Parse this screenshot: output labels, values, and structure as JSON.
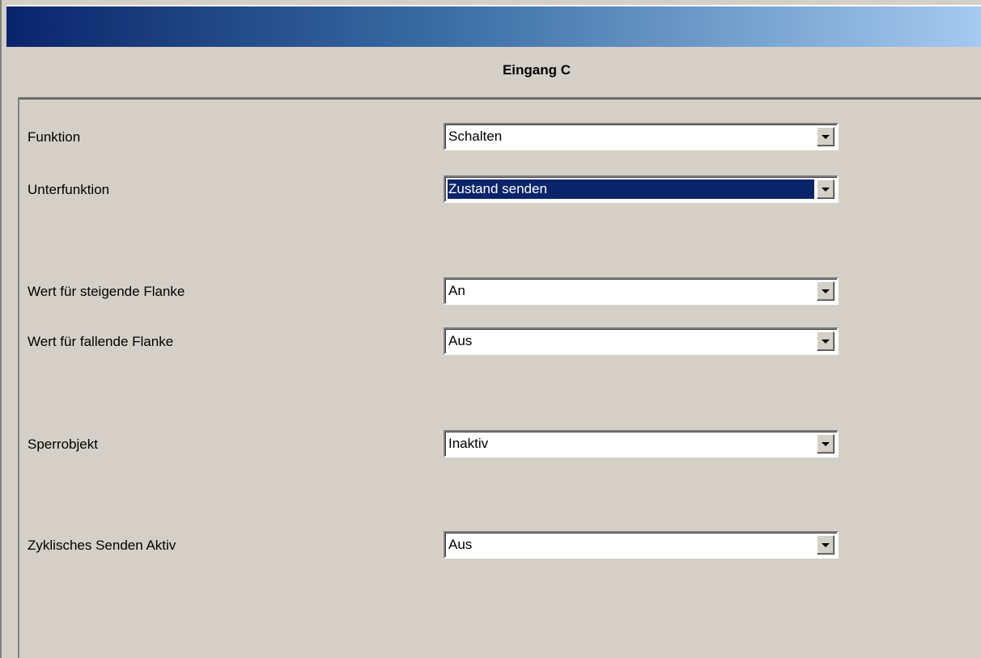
{
  "page": {
    "title": "Eingang C"
  },
  "params": [
    {
      "label": "Funktion",
      "value": "Schalten"
    },
    {
      "label": "Unterfunktion",
      "value": "Zustand senden"
    },
    {
      "label": "Wert für steigende Flanke",
      "value": "An"
    },
    {
      "label": "Wert für fallende Flanke",
      "value": "Aus"
    },
    {
      "label": "Sperrobjekt",
      "value": "Inaktiv"
    },
    {
      "label": "Zyklisches Senden Aktiv",
      "value": "Aus"
    }
  ],
  "icons": {
    "dropdown": "chevron-down-icon"
  },
  "colors": {
    "dialog_bg": "#d4d0c8",
    "title_gradient_start": "#0a246a",
    "title_gradient_end": "#a6caf0",
    "selection_bg": "#0a246a",
    "selection_fg": "#ffffff"
  }
}
